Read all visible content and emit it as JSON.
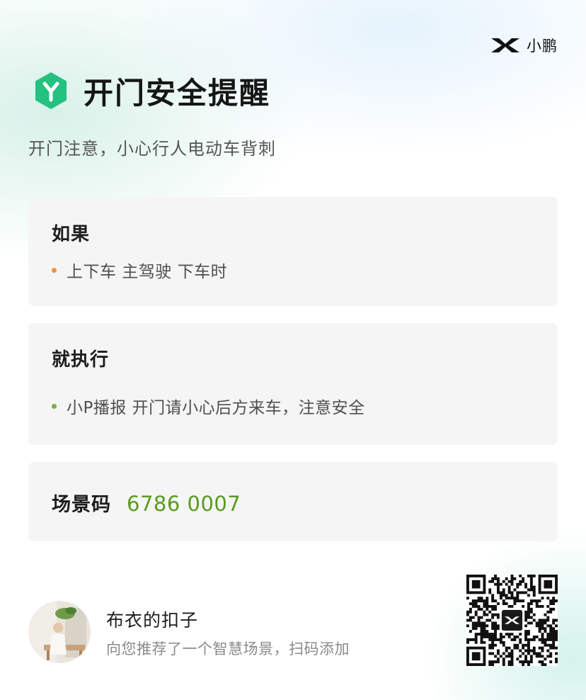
{
  "brand": {
    "name": "小鹏",
    "logo": "xpeng-x-logo-icon"
  },
  "header": {
    "icon": "hexagon-y-icon",
    "title": "开门安全提醒"
  },
  "subtitle": "开门注意，小心行人电动车背刺",
  "condition": {
    "title": "如果",
    "items": [
      {
        "text": "上下车 主驾驶 下车时",
        "dot_color": "#f0923a"
      }
    ]
  },
  "action": {
    "title": "就执行",
    "items": [
      {
        "text": "小P播报 开门请小心后方来车，注意安全",
        "dot_color": "#75b340"
      }
    ]
  },
  "scene_code": {
    "label": "场景码",
    "value": "6786 0007"
  },
  "share": {
    "user_name": "布衣的扣子",
    "description": "向您推荐了一个智慧场景，扫码添加",
    "avatar": "user-avatar-photo",
    "qr": "scene-qr-code"
  },
  "colors": {
    "accent_green": "#5a9b20",
    "hex_icon_green": "#24c181",
    "orange_dot": "#f0923a",
    "green_dot": "#75b340",
    "card_bg": "#f5f5f5"
  }
}
